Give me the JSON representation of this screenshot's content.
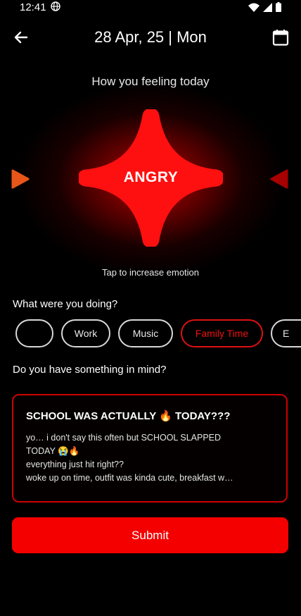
{
  "status_bar": {
    "time": "12:41",
    "icons": [
      "globe-icon",
      "wifi-icon",
      "signal-icon",
      "battery-icon"
    ]
  },
  "header": {
    "date": "28 Apr, 25 | Mon",
    "back_icon": "back-arrow-icon",
    "calendar_icon": "calendar-icon"
  },
  "emotion": {
    "heading": "How you feeling today",
    "current": "ANGRY",
    "hint": "Tap to increase emotion",
    "accent": "#ff1010",
    "prev_arrow_color": "#e8561a",
    "next_arrow_color": "#a80000"
  },
  "activity": {
    "label": "What were you doing?",
    "chips": [
      {
        "label": "",
        "selected": false
      },
      {
        "label": "Work",
        "selected": false
      },
      {
        "label": "Music",
        "selected": false
      },
      {
        "label": "Family Time",
        "selected": true
      },
      {
        "label": "E",
        "selected": false
      }
    ]
  },
  "mind": {
    "label": "Do you have something in mind?",
    "note_title": "SCHOOL WAS ACTUALLY 🔥 TODAY???",
    "note_lines": [
      "yo… i don't say this often but SCHOOL SLAPPED",
      "TODAY 😭🔥",
      "everything just hit right??",
      "woke up on time, outfit was kinda cute, breakfast w…"
    ]
  },
  "submit": {
    "label": "Submit"
  }
}
